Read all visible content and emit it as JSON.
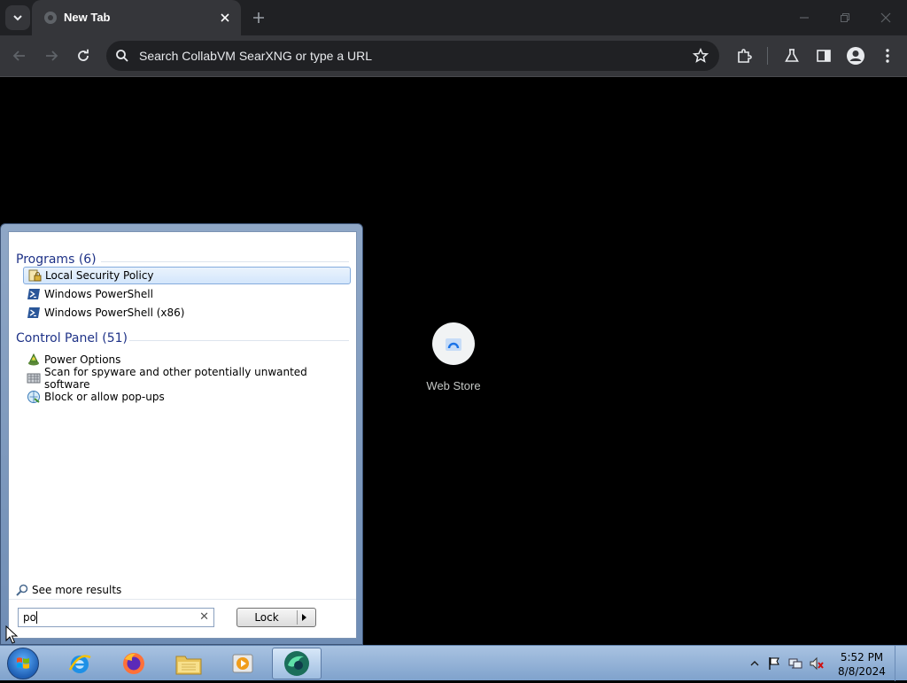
{
  "browser": {
    "tab": {
      "title": "New Tab"
    },
    "omnibox": {
      "placeholder": "Search CollabVM SearXNG or type a URL"
    },
    "shortcuts": [
      {
        "label": "Web Store"
      }
    ]
  },
  "start_menu": {
    "programs": {
      "header": "Programs (6)",
      "items": [
        {
          "label": "Local Security Policy",
          "selected": true
        },
        {
          "label": "Windows PowerShell"
        },
        {
          "label": "Windows PowerShell (x86)"
        }
      ]
    },
    "control_panel": {
      "header": "Control Panel (51)",
      "items": [
        {
          "label": "Power Options"
        },
        {
          "label": "Scan for spyware and other potentially unwanted software"
        },
        {
          "label": "Block or allow pop-ups"
        }
      ]
    },
    "see_more": "See more results",
    "search": {
      "value": "po"
    },
    "lock_label": "Lock"
  },
  "taskbar": {
    "clock": {
      "time": "5:52 PM",
      "date": "8/8/2024"
    }
  },
  "colors": {
    "chrome_dark": "#202124",
    "chrome_toolbar": "#35363a",
    "start_header": "#1e3287",
    "selection": "#d3e6fb"
  }
}
